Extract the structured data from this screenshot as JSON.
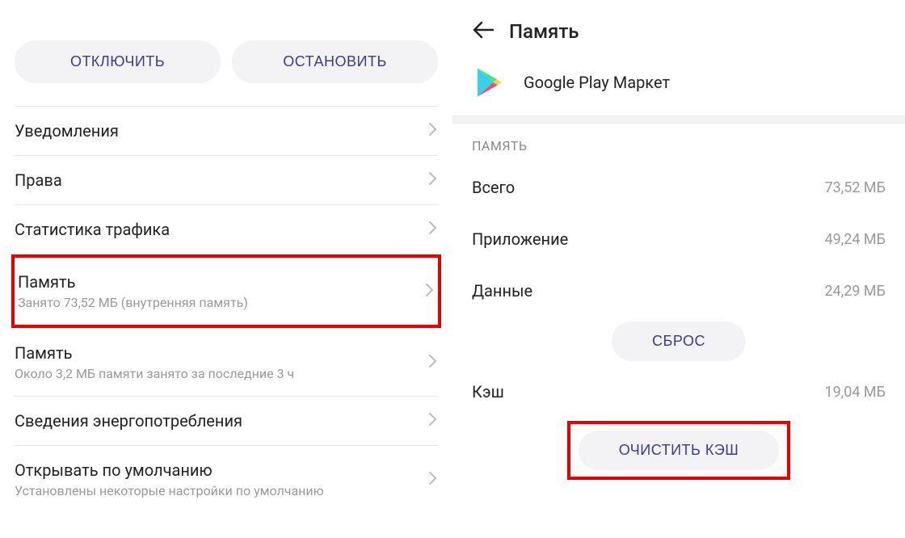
{
  "left": {
    "buttons": {
      "disable": "ОТКЛЮЧИТЬ",
      "stop": "ОСТАНОВИТЬ"
    },
    "items": {
      "notifications": {
        "title": "Уведомления"
      },
      "permissions": {
        "title": "Права"
      },
      "traffic": {
        "title": "Статистика трафика"
      },
      "storage": {
        "title": "Память",
        "subtitle": "Занято 73,52 МБ (внутренняя память)"
      },
      "memory": {
        "title": "Память",
        "subtitle": "Около 3,2 МБ памяти занято за последние 3 ч"
      },
      "power": {
        "title": "Сведения энергопотребления"
      },
      "defaults": {
        "title": "Открывать по умолчанию",
        "subtitle": "Установлены некоторые настройки по умолчанию"
      }
    }
  },
  "right": {
    "header_title": "Память",
    "app_name": "Google Play Маркет",
    "section_label": "ПАМЯТЬ",
    "stats": {
      "total_label": "Всего",
      "total_value": "73,52 МБ",
      "app_label": "Приложение",
      "app_value": "49,24 МБ",
      "data_label": "Данные",
      "data_value": "24,29 МБ",
      "cache_label": "Кэш",
      "cache_value": "19,04 МБ"
    },
    "buttons": {
      "reset": "СБРОС",
      "clear_cache": "ОЧИСТИТЬ КЭШ"
    }
  }
}
